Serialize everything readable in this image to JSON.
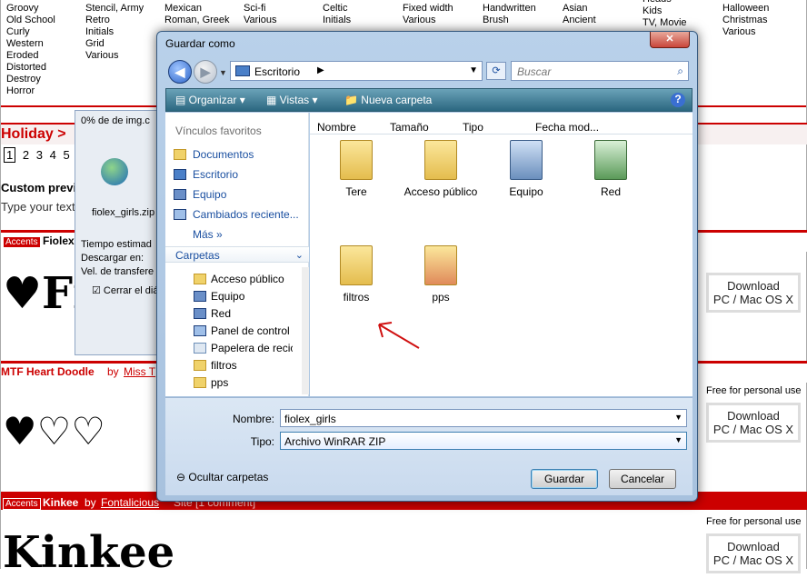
{
  "categories": [
    {
      "items": [
        "Groovy",
        "Old School",
        "Curly",
        "Western",
        "Eroded",
        "Distorted",
        "Destroy",
        "Horror"
      ]
    },
    {
      "items": [
        "Stencil, Army",
        "Retro",
        "Initials",
        "Grid",
        "Various"
      ]
    },
    {
      "items": [
        "Mexican",
        "Roman, Greek"
      ]
    },
    {
      "items": [
        "Sci-fi",
        "Various"
      ]
    },
    {
      "items": [
        "Celtic",
        "Initials"
      ]
    },
    {
      "items": [
        "Fixed width",
        "Various"
      ]
    },
    {
      "items": [
        "Handwritten",
        "Brush"
      ]
    },
    {
      "items": [
        "Asian",
        "Ancient"
      ]
    },
    {
      "items": [
        "Heads",
        "Kids",
        "TV, Movie"
      ]
    },
    {
      "items": [
        "Halloween",
        "Christmas",
        "Various"
      ]
    }
  ],
  "holiday": {
    "title": "Holiday >",
    "pages": [
      "1",
      "2",
      "3",
      "4",
      "5"
    ]
  },
  "custom_preview": {
    "label": "Custom previ",
    "input_placeholder": "Type your text"
  },
  "fonts": [
    {
      "accent": "Accents",
      "name": "Fiolex"
    },
    {
      "accent": "",
      "name": "MTF Heart Doodle",
      "by": "by",
      "author": "Miss T"
    },
    {
      "accent": "Accents",
      "name": "Kinkee",
      "by": "by",
      "author": "Fontalicious",
      "extra": "Site  [1 comment]"
    }
  ],
  "download": {
    "label": "Download",
    "sub": "PC / Mac OS X",
    "free": "Free for personal use"
  },
  "progress": {
    "title": "0% de  de img.c",
    "file": "fiolex_girls.zip",
    "time": "Tiempo estimad",
    "download_to": "Descargar en:",
    "speed": "Vel. de transfere",
    "close_label": "Cerrar el diál"
  },
  "dialog": {
    "title": "Guardar como",
    "address": "Escritorio",
    "search_placeholder": "Buscar",
    "toolbar": {
      "organize": "Organizar",
      "views": "Vistas",
      "new_folder": "Nueva carpeta"
    },
    "favorites_header": "Vínculos favoritos",
    "favorites": [
      "Documentos",
      "Escritorio",
      "Equipo",
      "Cambiados reciente...",
      "Más"
    ],
    "folders_header": "Carpetas",
    "tree": [
      "Acceso público",
      "Equipo",
      "Red",
      "Panel de control",
      "Papelera de recic",
      "filtros",
      "pps"
    ],
    "columns": [
      "Nombre",
      "Tamaño",
      "Tipo",
      "Fecha mod..."
    ],
    "files": [
      "Tere",
      "Acceso público",
      "Equipo",
      "Red",
      "filtros",
      "pps"
    ],
    "filename_label": "Nombre:",
    "filename": "fiolex_girls",
    "type_label": "Tipo:",
    "type": "Archivo WinRAR ZIP",
    "hide_folders": "Ocultar carpetas",
    "save": "Guardar",
    "cancel": "Cancelar"
  }
}
